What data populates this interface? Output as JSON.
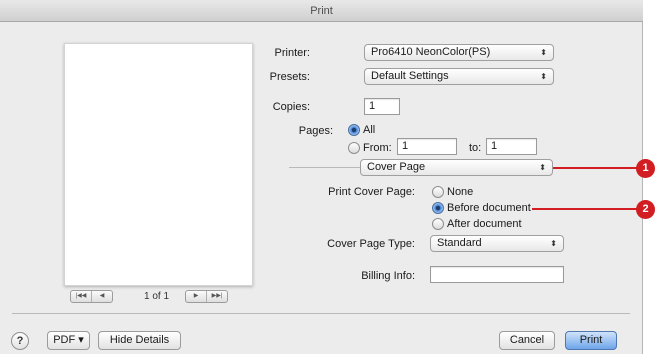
{
  "window": {
    "title": "Print"
  },
  "preview": {
    "page_indicator": "1 of 1",
    "nav_icons": [
      "first-page-icon",
      "previous-page-icon",
      "next-page-icon",
      "last-page-icon"
    ]
  },
  "printer": {
    "label": "Printer:",
    "value": "Pro6410 NeonColor(PS)"
  },
  "presets": {
    "label": "Presets:",
    "value": "Default Settings"
  },
  "copies": {
    "label": "Copies:",
    "value": "1"
  },
  "pages": {
    "label": "Pages:",
    "all_label": "All",
    "from_label": "From:",
    "from_value": "1",
    "to_label": "to:",
    "to_value": "1",
    "selected": "All"
  },
  "panel": {
    "value": "Cover Page"
  },
  "cover_page": {
    "label": "Print Cover Page:",
    "options": [
      "None",
      "Before document",
      "After document"
    ],
    "selected": "Before document",
    "type_label": "Cover Page Type:",
    "type_value": "Standard",
    "billing_label": "Billing Info:",
    "billing_value": ""
  },
  "footer": {
    "help_label": "?",
    "pdf_label": "PDF ▾",
    "hide_details_label": "Hide Details",
    "cancel_label": "Cancel",
    "print_label": "Print"
  },
  "callouts": [
    "1",
    "2"
  ],
  "colors": {
    "callout": "#d21d22",
    "default_button": "#6fa5ea",
    "window_bg": "#ececec"
  }
}
